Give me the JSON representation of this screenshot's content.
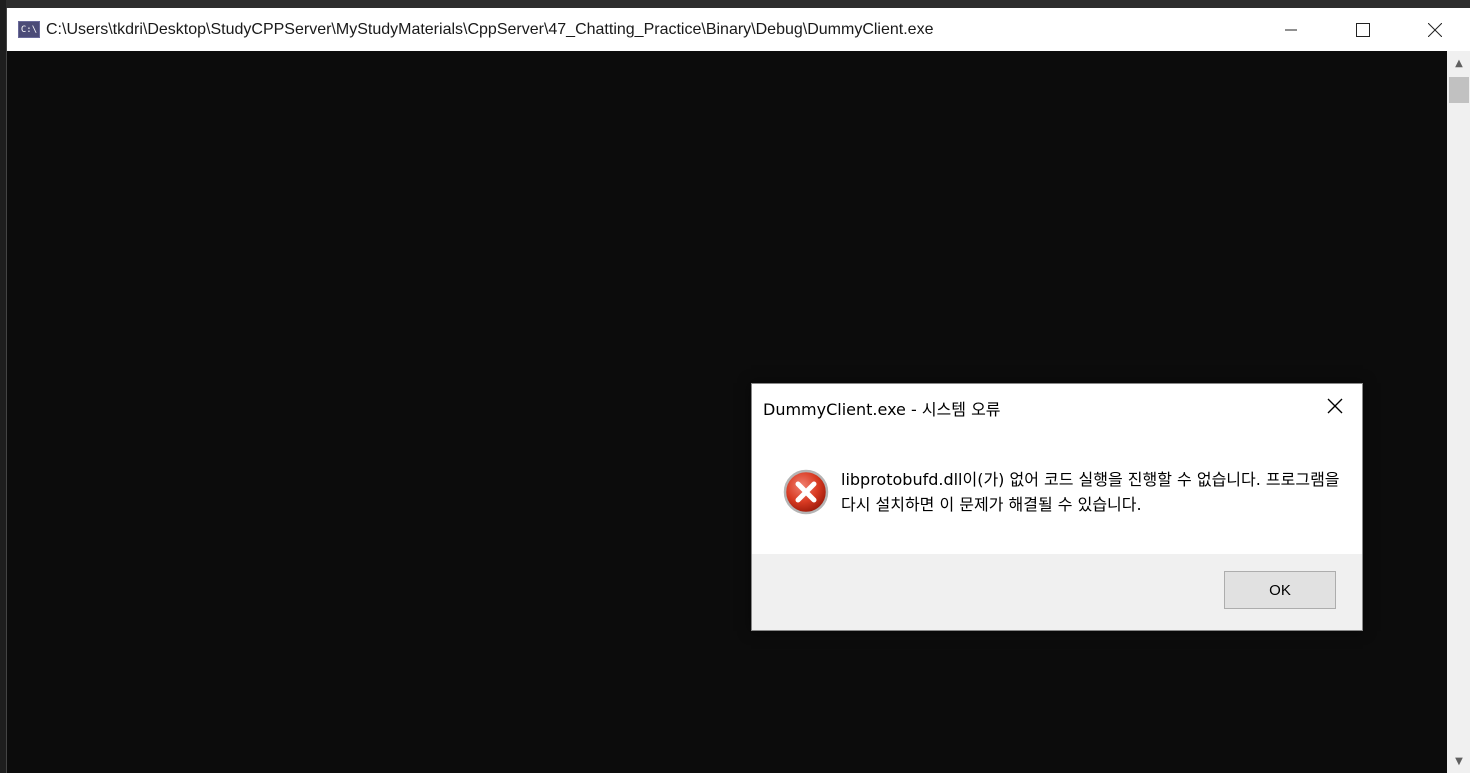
{
  "window": {
    "title": "C:\\Users\\tkdri\\Desktop\\StudyCPPServer\\MyStudyMaterials\\CppServer\\47_Chatting_Practice\\Binary\\Debug\\DummyClient.exe",
    "icon": "console-app-icon",
    "buttons": {
      "minimize": "—",
      "maximize": "☐",
      "close": "✕"
    }
  },
  "scrollbar": {
    "up": "▲",
    "down": "▼"
  },
  "dialog": {
    "title": "DummyClient.exe - 시스템 오류",
    "message": "libprotobufd.dll이(가) 없어 코드 실행을 진행할 수 없습니다. 프로그램을 다시 설치하면 이 문제가 해결될 수 있습니다.",
    "ok_label": "OK",
    "icon": "error-icon",
    "error_color": "#c42b1c"
  }
}
